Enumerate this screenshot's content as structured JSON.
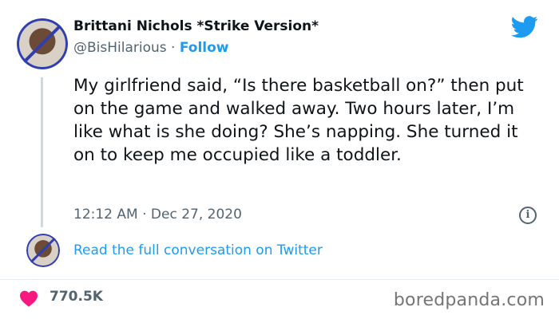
{
  "author": {
    "display_name": "Brittani Nichols *Strike Version*",
    "handle": "@BisHilarious",
    "separator": " · ",
    "follow_label": "Follow"
  },
  "tweet": {
    "text": "My girlfriend said, “Is there basketball on?” then put on the game and walked away. Two hours later, I’m like what is she doing? She’s napping. She turned it on to keep me occupied like a toddler.",
    "timestamp": "12:12 AM · Dec 27, 2020"
  },
  "info_icon": {
    "glyph": "i"
  },
  "conversation": {
    "link_label": "Read the full conversation on Twitter"
  },
  "engagement": {
    "likes": "770.5K"
  },
  "watermark": "boredpanda.com",
  "colors": {
    "accent": "#1d9bf0",
    "heart": "#f91880",
    "secondary_text": "#536471"
  }
}
